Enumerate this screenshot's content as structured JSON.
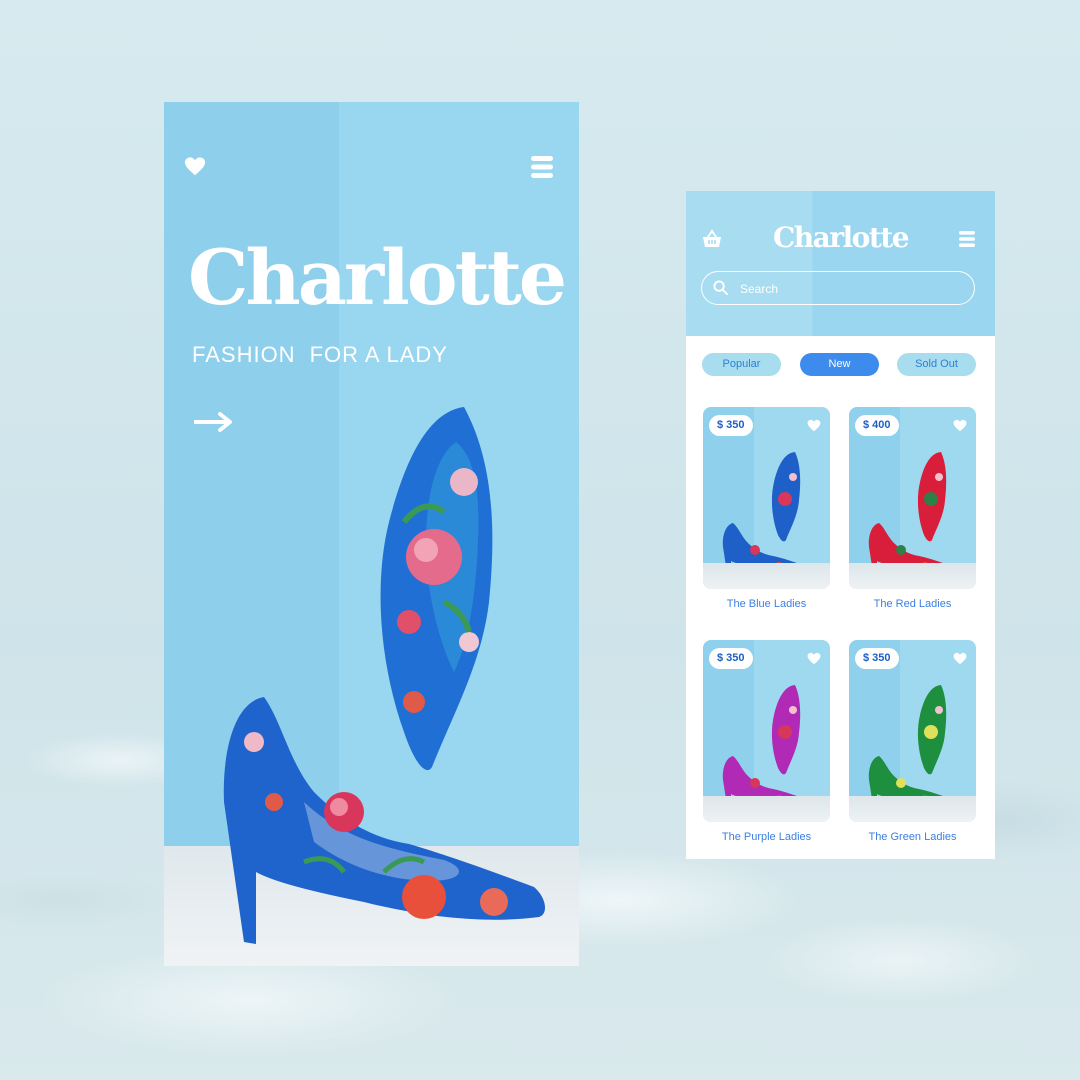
{
  "screen1": {
    "brand": "Charlotte",
    "tagline": [
      "FASHION",
      "FOR A LADY"
    ],
    "icons": {
      "left": "heart-icon",
      "right": "menu-icon",
      "cta": "arrow-right-icon"
    }
  },
  "screen2": {
    "brand": "Charlotte",
    "search": {
      "placeholder": "Search"
    },
    "filters": [
      {
        "label": "Popular",
        "active": false
      },
      {
        "label": "New",
        "active": true
      },
      {
        "label": "Sold Out",
        "active": false
      }
    ],
    "products": [
      {
        "price": "$ 350",
        "name": "The Blue Ladies",
        "color": "#1e5fc8",
        "accent": "#d8365a"
      },
      {
        "price": "$ 400",
        "name": "The Red Ladies",
        "color": "#d81e3a",
        "accent": "#2f7f47"
      },
      {
        "price": "$ 350",
        "name": "The Purple Ladies",
        "color": "#b02ab6",
        "accent": "#d8365a"
      },
      {
        "price": "$ 350",
        "name": "The Green Ladies",
        "color": "#1d8f3e",
        "accent": "#e0e05a"
      }
    ]
  },
  "colors": {
    "sky": "#99d6ef",
    "accent_blue": "#3d8bec",
    "white": "#ffffff"
  }
}
